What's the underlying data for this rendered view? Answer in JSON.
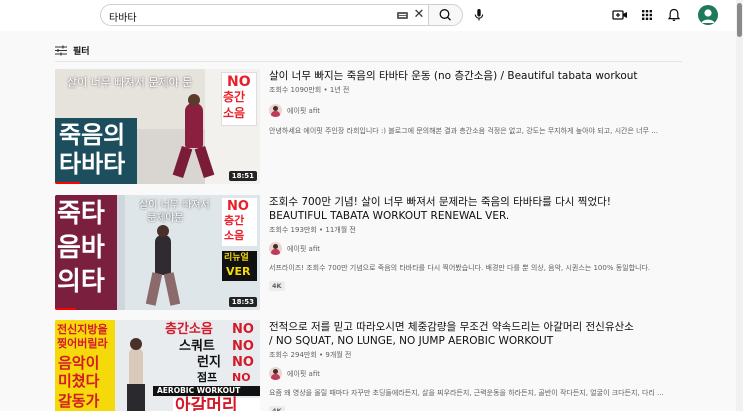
{
  "search": {
    "query": "타바타"
  },
  "filter": {
    "label": "필터"
  },
  "results": [
    {
      "title": "살이 너무 빠지는 죽음의 타바타 운동 (no 층간소음) / Beautiful tabata workout",
      "meta": "조회수 1090만회 • 1년 전",
      "channel": "에이핏 afit",
      "description": "안녕하세요 에이핏 주인장 라희입니다 :) 블로그에 문의해본 결과 층간소음 걱정은 없고, 강도는 무지하게 높아야 되고, 시간은 너무 ...",
      "duration": "18:51",
      "watched_fraction": 0.12,
      "thumb": {
        "top": "살이 너무 빠져서 문제야 문",
        "no": "NO",
        "no_sub1": "층간",
        "no_sub2": "소음",
        "line1": "죽음의",
        "line2": "타바타"
      }
    },
    {
      "title": "조회수 700만 기념! 살이 너무 빠져서 문제라는 죽음의 타바타를 다시 찍었다!",
      "title2": "BEAUTIFUL TABATA WORKOUT RENEWAL VER.",
      "meta": "조회수 193만회 • 11개월 전",
      "channel": "에이핏 afit",
      "description": "서프라이즈! 조회수 700만 기념으로 죽음의 타바타를 다시 찍어봤습니다. 배경만 다를 뿐 의상, 음악, 시퀀스는 100% 동일합니다.",
      "badge": "4K",
      "duration": "18:53",
      "watched_fraction": 0.1,
      "thumb": {
        "top1": "살이 너무 빠져서",
        "top2": "문제야문",
        "c1": "죽타",
        "c2": "음바",
        "c3": "의타",
        "no": "NO",
        "no_sub1": "층간",
        "no_sub2": "소음",
        "renew1": "리뉴얼",
        "renew2": "VER"
      }
    },
    {
      "title": "전적으로 저를 믿고 따라오시면 체중감량을 무조건 약속드리는 아갈머리 전신유산소",
      "title2": "/ NO SQUAT, NO LUNGE, NO JUMP AEROBIC WORKOUT",
      "meta": "조회수 294만회 • 9개월 전",
      "channel": "에이핏 afit",
      "description": "요즘 왜 영상을 올릴 때마다 자꾸만 초딩들에라든지, 살을 찌우라든지, 근력운동을 하라든지, 골반이 작다든지, 얼굴이 크다든지, 다리 ...",
      "badge": "4K",
      "thumb": {
        "y1": "전신지방을",
        "y2": "찢어버릴라",
        "y3": "음악이",
        "y4": "미쳤다",
        "y5": "갈동가",
        "r1": "층간소음",
        "r2": "스쿼트",
        "r3": "런지",
        "r4": "점프",
        "no": "NO",
        "aero": "AEROBIC WORKOUT",
        "big": "아갈머리"
      }
    }
  ],
  "colors": {
    "accent_red": "#ff0000",
    "thumb_teal": "#1c4e5e",
    "thumb_maroon": "#7a1f3d",
    "thumb_yellow": "#f5d90a"
  }
}
